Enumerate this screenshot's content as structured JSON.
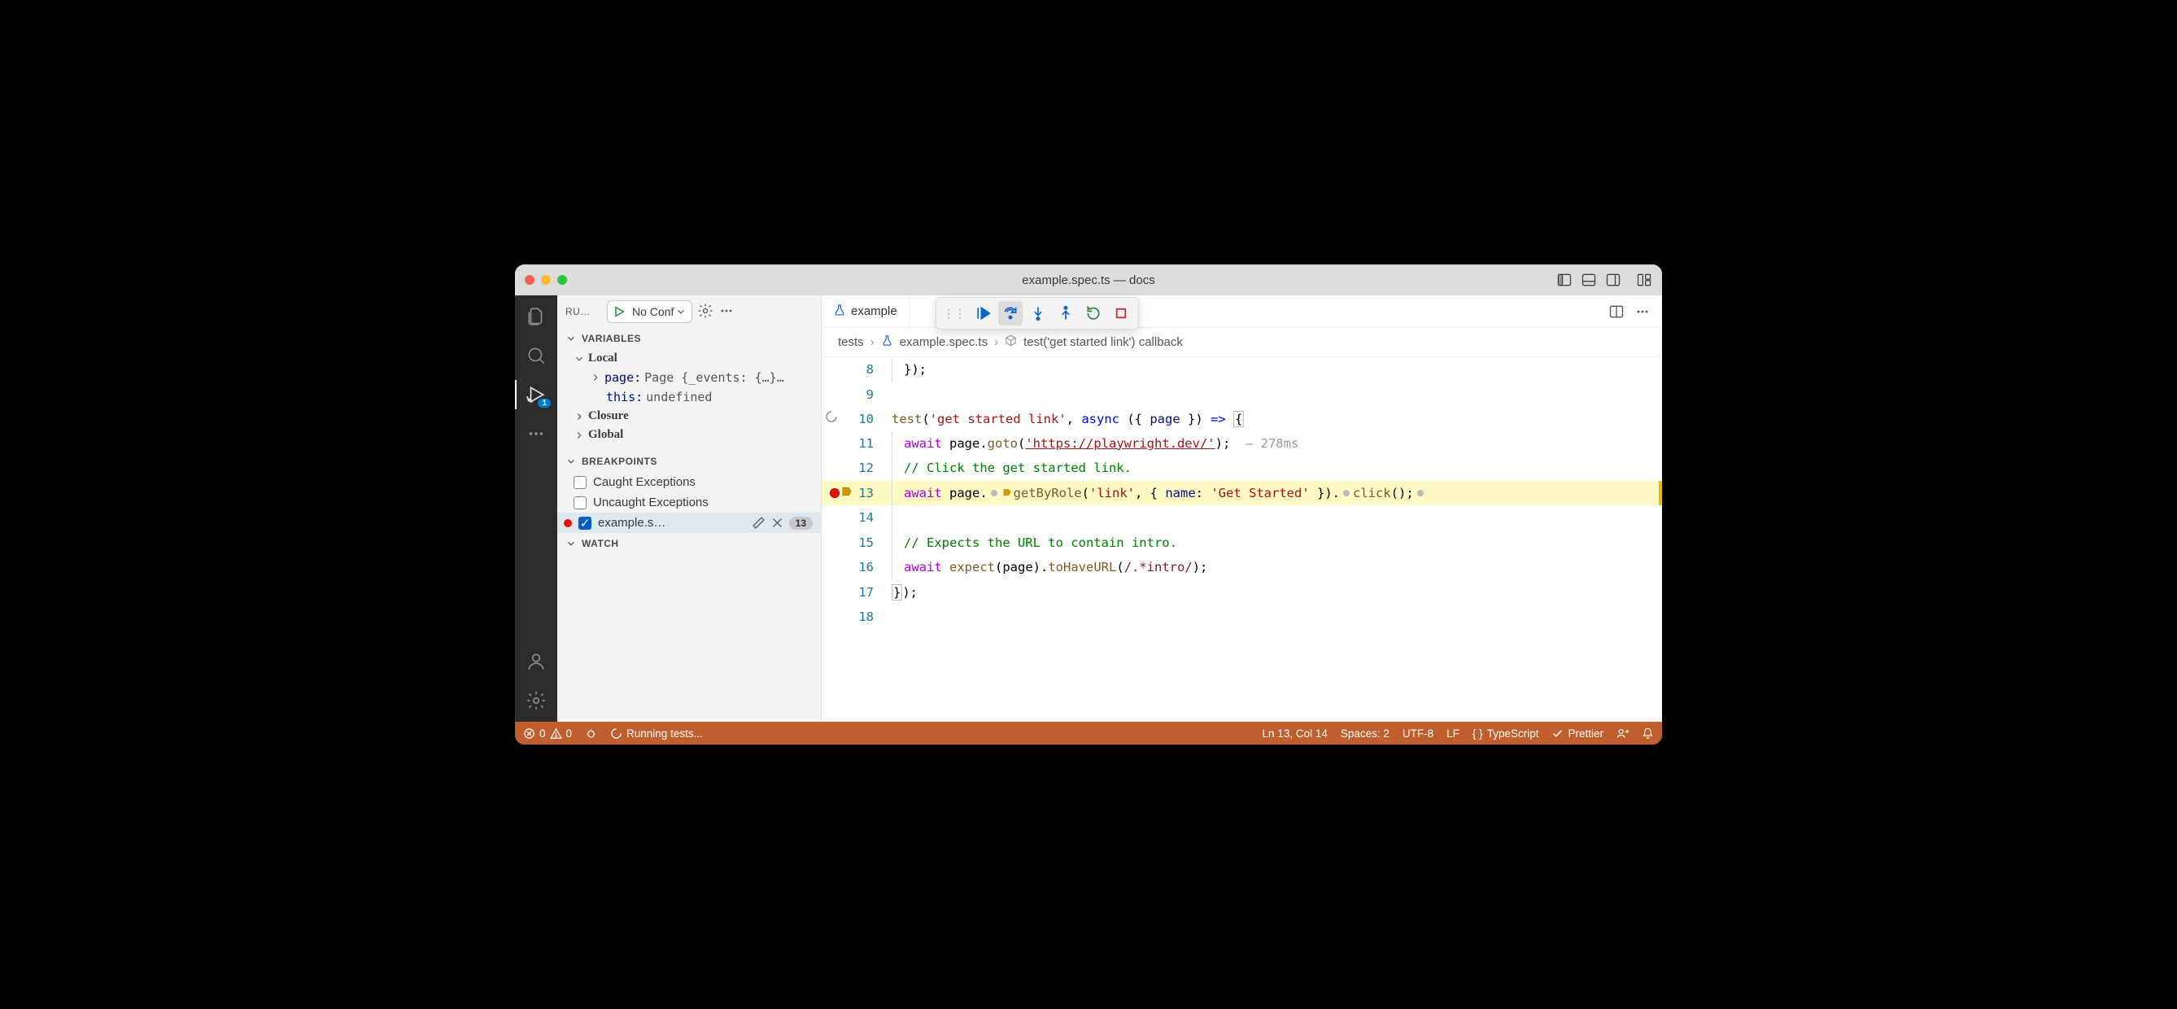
{
  "titlebar": {
    "title": "example.spec.ts — docs"
  },
  "activity": {
    "badge": "1"
  },
  "debug_panel": {
    "label": "RU…",
    "config": "No Conf",
    "sections": {
      "variables": "VARIABLES",
      "local": "Local",
      "page_key": "page:",
      "page_val": "Page {_events: {…}…",
      "this_key": "this:",
      "this_val": "undefined",
      "closure": "Closure",
      "global": "Global",
      "breakpoints": "BREAKPOINTS",
      "caught": "Caught Exceptions",
      "uncaught": "Uncaught Exceptions",
      "bp_file": "example.s…",
      "bp_line": "13",
      "watch": "WATCH"
    }
  },
  "tab": {
    "name": "example"
  },
  "breadcrumbs": {
    "root": "tests",
    "file": "example.spec.ts",
    "symbol": "test('get started link') callback"
  },
  "code": {
    "l8": "});",
    "l10_test": "test",
    "l10_str": "'get started link'",
    "l10_async": "async",
    "l10_page": "page",
    "l11_await": "await",
    "l11_goto": "goto",
    "l11_url": "'https://playwright.dev/'",
    "l11_time": "278ms",
    "l12_com": "// Click the get started link.",
    "l13_await": "await",
    "l13_getbyrole": "getByRole",
    "l13_link": "'link'",
    "l13_name": "name",
    "l13_getstarted": "'Get Started'",
    "l13_click": "click",
    "l15_com": "// Expects the URL to contain intro.",
    "l16_await": "await",
    "l16_expect": "expect",
    "l16_tohaveurl": "toHaveURL",
    "l16_regex": "/.*intro/",
    "l17": "});"
  },
  "status": {
    "errors": "0",
    "warnings": "0",
    "running": "Running tests...",
    "pos": "Ln 13, Col 14",
    "spaces": "Spaces: 2",
    "encoding": "UTF-8",
    "eol": "LF",
    "lang": "TypeScript",
    "prettier": "Prettier"
  }
}
